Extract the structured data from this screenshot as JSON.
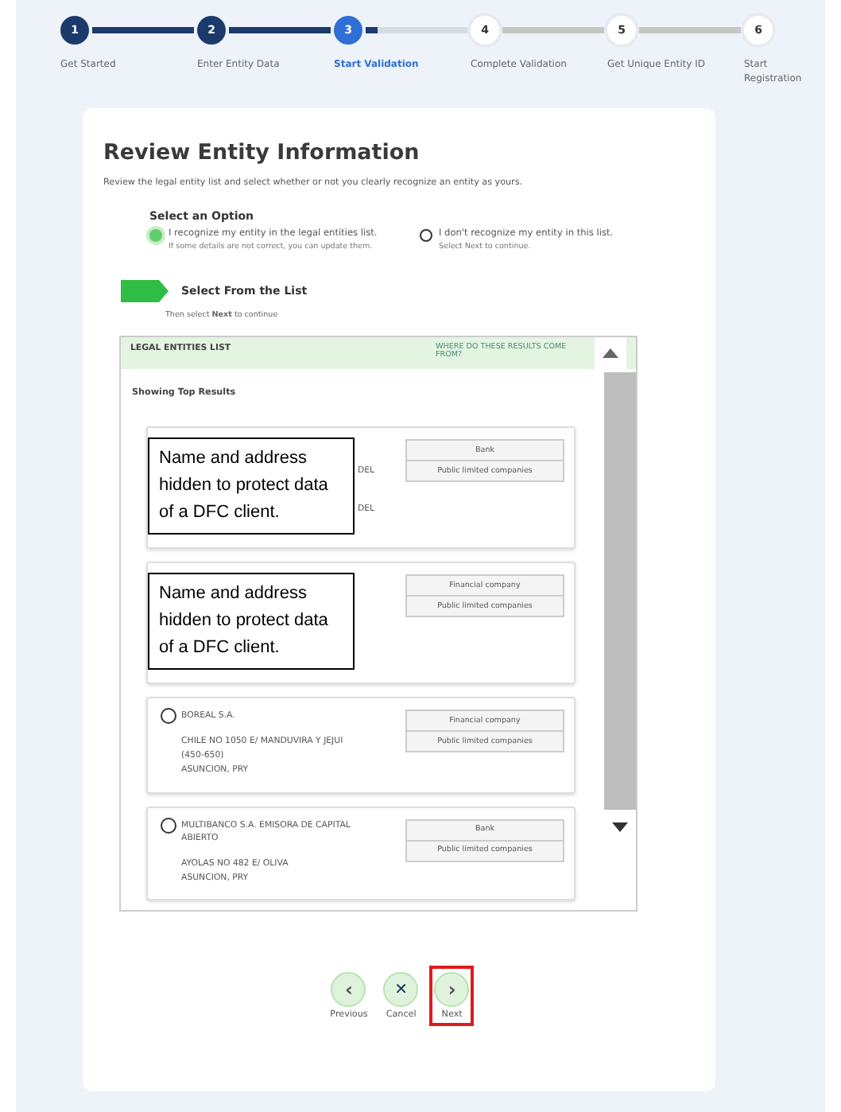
{
  "steps": [
    {
      "number": "1",
      "label": "Get Started",
      "completed": true,
      "current": false
    },
    {
      "number": "2",
      "label": "Enter Entity Data",
      "completed": true,
      "current": false
    },
    {
      "number": "3",
      "label": "Start Validation",
      "completed": false,
      "current": true
    },
    {
      "number": "4",
      "label": "Complete Validation",
      "completed": false,
      "current": false
    },
    {
      "number": "5",
      "label": "Get Unique Entity ID",
      "completed": false,
      "current": false
    },
    {
      "number": "6",
      "label": "Start Registration",
      "completed": false,
      "current": false
    }
  ],
  "title": "Review Entity Information",
  "description": "Review the legal entity list and select whether or not you clearly recognize an entity as yours.",
  "option_heading": "Select an Option",
  "options": [
    {
      "label": "I recognize my entity in the legal entities list.",
      "hint": "If some details are not correct, you can update them.",
      "selected": true
    },
    {
      "label": "I don't recognize my entity in this list.",
      "hint": "Select Next to continue.",
      "selected": false
    }
  ],
  "select_from_list": {
    "title": "Select From the List",
    "hint": "Then select **Next** to continue"
  },
  "list": {
    "title": "LEGAL ENTITIES LIST",
    "info_link": "WHERE DO THESE RESULTS COME FROM?",
    "subtitle": "Showing Top Results",
    "entities": [
      {
        "kind": "redacted",
        "note": "Name and address hidden to protect data of a DFC client.",
        "fragments": [
          "DEL",
          "DEL"
        ],
        "tags": [
          "Bank",
          "Public limited companies"
        ]
      },
      {
        "kind": "redacted",
        "note": "Name and address hidden to protect data of a DFC client.",
        "tags": [
          "Financial company",
          "Public limited companies"
        ]
      },
      {
        "kind": "entity",
        "name": "BOREAL S.A.",
        "address": [
          "CHILE NO 1050 E/ MANDUVIRA Y JEJUI (450-650)",
          "ASUNCION, PRY"
        ],
        "tags": [
          "Financial company",
          "Public limited companies"
        ],
        "selected": false
      },
      {
        "kind": "entity",
        "name": "MULTIBANCO S.A. EMISORA DE CAPITAL ABIERTO",
        "address": [
          "AYOLAS NO 482 E/ OLIVA",
          "ASUNCION, PRY"
        ],
        "tags": [
          "Bank",
          "Public limited companies"
        ],
        "selected": false
      }
    ]
  },
  "buttons": [
    {
      "kind": "previous",
      "icon": "‹",
      "label": "Previous",
      "highlighted": false
    },
    {
      "kind": "cancel",
      "icon": "✕",
      "label": "Cancel",
      "highlighted": false
    },
    {
      "kind": "next",
      "icon": "›",
      "label": "Next",
      "highlighted": true
    }
  ]
}
